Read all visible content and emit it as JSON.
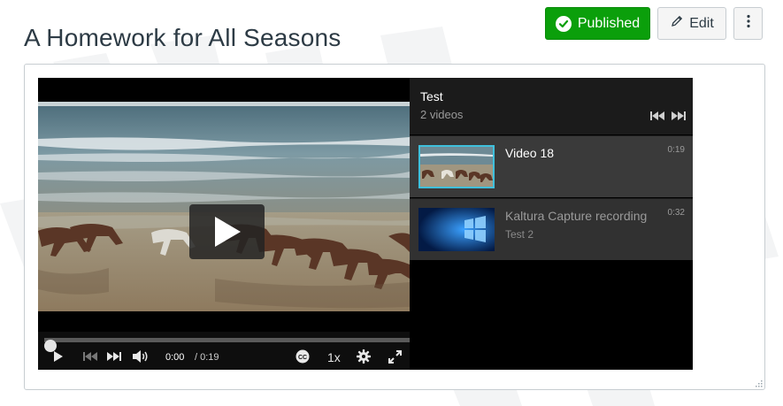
{
  "page": {
    "title": "A Homework for All Seasons",
    "published_label": "Published",
    "edit_label": "Edit",
    "colors": {
      "published_bg": "#0b9f0b",
      "title": "#2d3b45",
      "thumb_highlight": "#3fc0dc"
    }
  },
  "player": {
    "current_time": "0:00",
    "duration": "/ 0:19",
    "speed": "1x",
    "progress": 0,
    "icons": [
      "play-icon",
      "skip-back-icon",
      "skip-forward-icon",
      "volume-icon",
      "closed-captions-icon",
      "gear-icon",
      "fullscreen-icon",
      "big-play-icon"
    ]
  },
  "playlist": {
    "title": "Test",
    "count": "2 videos",
    "items": [
      {
        "name": "Video 18",
        "duration": "0:19",
        "subtitle": ""
      },
      {
        "name": "Kaltura Capture recording",
        "duration": "0:32",
        "subtitle": "Test 2"
      }
    ]
  }
}
